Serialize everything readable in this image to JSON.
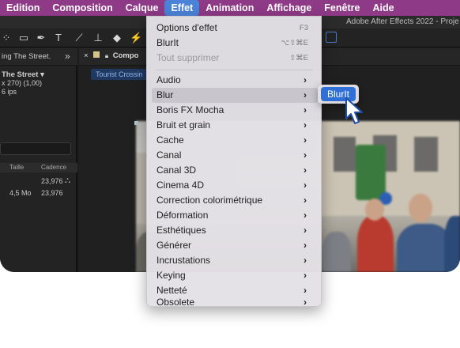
{
  "menubar": {
    "items": [
      "Edition",
      "Composition",
      "Calque",
      "Effet",
      "Animation",
      "Affichage",
      "Fenêtre",
      "Aide"
    ],
    "active_index": 3,
    "color": "#8e3a87",
    "active_color": "#4a83d8"
  },
  "window": {
    "title": "Adobe After Effects 2022 - Proje"
  },
  "project_panel": {
    "title": "ing The Street.",
    "item_name": "The Street",
    "item_details": "x 270) (1,00)",
    "item_fps": "6 ips",
    "columns": [
      "Taille",
      "Cadence"
    ],
    "rows": [
      {
        "size": "",
        "fps": "23,976"
      },
      {
        "size": "4,5 Mo",
        "fps": "23,976"
      }
    ]
  },
  "comp_panel": {
    "tab_label": "Compo",
    "sub_tab_label": "Tourist Crossin"
  },
  "effect_menu": {
    "items": [
      {
        "label": "Options d'effet",
        "shortcut": "F3"
      },
      {
        "label": "BlurIt",
        "shortcut": "⌥⇧⌘E"
      },
      {
        "label": "Tout supprimer",
        "shortcut": "⇧⌘E",
        "disabled": true
      },
      {
        "label": "Audio",
        "submenu": true
      },
      {
        "label": "Blur",
        "submenu": true,
        "highlighted": true
      },
      {
        "label": "Boris FX Mocha",
        "submenu": true
      },
      {
        "label": "Bruit et grain",
        "submenu": true
      },
      {
        "label": "Cache",
        "submenu": true
      },
      {
        "label": "Canal",
        "submenu": true
      },
      {
        "label": "Canal 3D",
        "submenu": true
      },
      {
        "label": "Cinema 4D",
        "submenu": true
      },
      {
        "label": "Correction colorimétrique",
        "submenu": true
      },
      {
        "label": "Déformation",
        "submenu": true
      },
      {
        "label": "Esthétiques",
        "submenu": true
      },
      {
        "label": "Générer",
        "submenu": true
      },
      {
        "label": "Incrustations",
        "submenu": true
      },
      {
        "label": "Keying",
        "submenu": true
      },
      {
        "label": "Netteté",
        "submenu": true
      },
      {
        "label": "Obsolete",
        "submenu": true
      }
    ]
  },
  "blur_submenu": {
    "items": [
      "BlurIt"
    ],
    "selected_color": "#2f6fd6"
  }
}
